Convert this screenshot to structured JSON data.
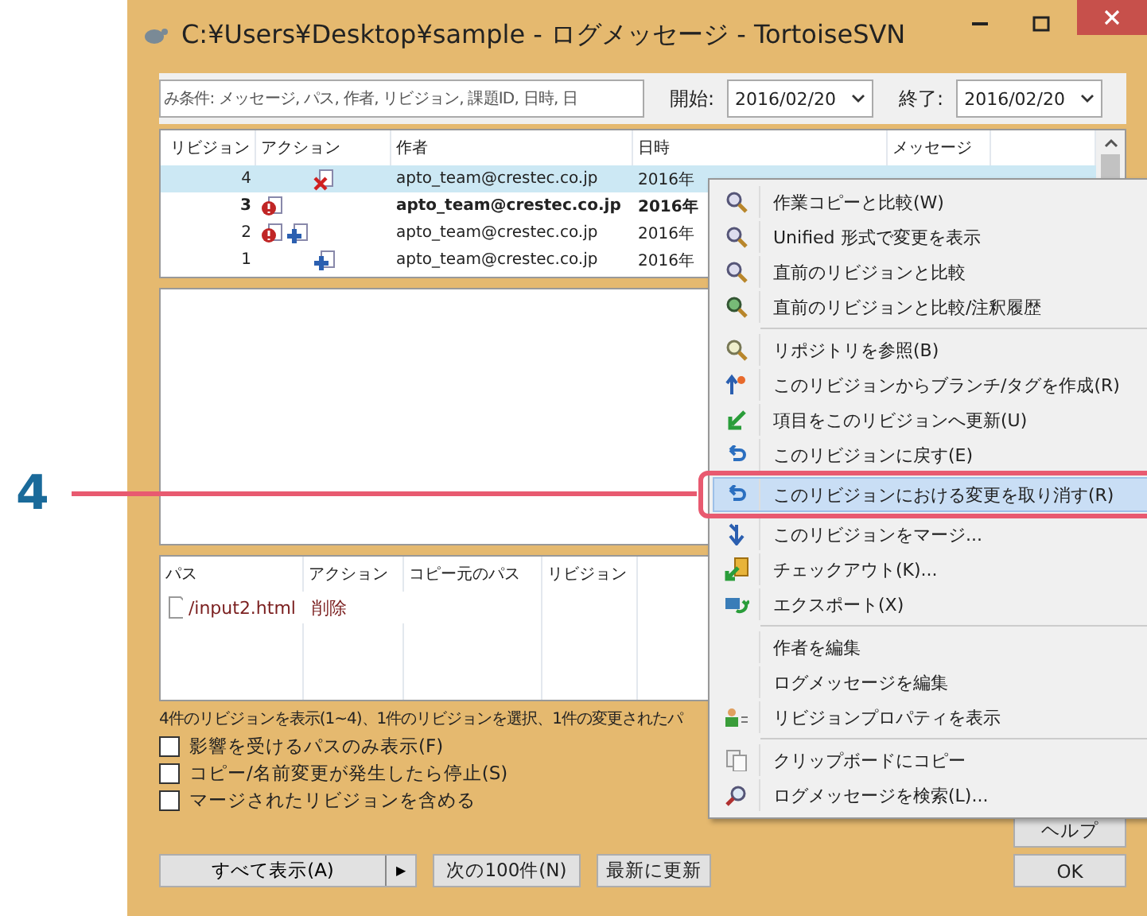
{
  "window": {
    "title": "C:¥Users¥Desktop¥sample - ログメッセージ - TortoiseSVN"
  },
  "filter": {
    "placeholder": "み条件: メッセージ, パス, 作者, リビジョン, 課題ID, 日時, 日",
    "from_label": "開始:",
    "from_value": "2016/02/20",
    "to_label": "終了:",
    "to_value": "2016/02/20"
  },
  "log_table": {
    "columns": [
      "リビジョン",
      "アクション",
      "作者",
      "日時",
      "メッセージ"
    ],
    "rows": [
      {
        "revision": "4",
        "deleted": true,
        "replaced": false,
        "added": false,
        "author": "apto_team@crestec.co.jp",
        "date": "2016年",
        "selected": true,
        "bold": false
      },
      {
        "revision": "3",
        "deleted": false,
        "replaced": true,
        "added": false,
        "author": "apto_team@crestec.co.jp",
        "date": "2016年",
        "selected": false,
        "bold": true
      },
      {
        "revision": "2",
        "deleted": false,
        "replaced": true,
        "added": true,
        "author": "apto_team@crestec.co.jp",
        "date": "2016年",
        "selected": false,
        "bold": false
      },
      {
        "revision": "1",
        "deleted": false,
        "replaced": false,
        "added": true,
        "author": "apto_team@crestec.co.jp",
        "date": "2016年",
        "selected": false,
        "bold": false
      }
    ]
  },
  "paths_table": {
    "columns": [
      "パス",
      "アクション",
      "コピー元のパス",
      "リビジョン"
    ],
    "rows": [
      {
        "path": "/input2.html",
        "action": "削除"
      }
    ]
  },
  "status": "4件のリビジョンを表示(1~4)、1件のリビジョンを選択、1件の変更されたパ",
  "options": [
    {
      "label": "影響を受けるパスのみ表示(F)",
      "checked": false
    },
    {
      "label": "コピー/名前変更が発生したら停止(S)",
      "checked": false
    },
    {
      "label": "マージされたリビジョンを含める",
      "checked": false
    }
  ],
  "buttons": {
    "show_all": "すべて表示(A)",
    "split_arrow": "▶",
    "next": "次の100件(N)",
    "refresh": "最新に更新",
    "help": "ヘルプ",
    "ok": "OK"
  },
  "context_menu": {
    "groups": [
      [
        {
          "label": "作業コピーと比較(W)",
          "selected": false
        },
        {
          "label": "Unified 形式で変更を表示",
          "selected": false
        },
        {
          "label": "直前のリビジョンと比較",
          "selected": false
        },
        {
          "label": "直前のリビジョンと比較/注釈履歴",
          "selected": false
        }
      ],
      [
        {
          "label": "リポジトリを参照(B)",
          "selected": false
        },
        {
          "label": "このリビジョンからブランチ/タグを作成(R)",
          "selected": false
        },
        {
          "label": "項目をこのリビジョンへ更新(U)",
          "selected": false
        },
        {
          "label": "このリビジョンに戻す(E)",
          "selected": false
        },
        {
          "label": "このリビジョンにおける変更を取り消す(R)",
          "selected": true
        },
        {
          "label": "このリビジョンをマージ...",
          "selected": false
        },
        {
          "label": "チェックアウト(K)...",
          "selected": false
        },
        {
          "label": "エクスポート(X)",
          "selected": false
        }
      ],
      [
        {
          "label": "作者を編集",
          "selected": false
        },
        {
          "label": "ログメッセージを編集",
          "selected": false
        },
        {
          "label": "リビジョンプロパティを表示",
          "selected": false
        }
      ],
      [
        {
          "label": "クリップボードにコピー",
          "selected": false
        },
        {
          "label": "ログメッセージを検索(L)...",
          "selected": false
        }
      ]
    ]
  },
  "callout": {
    "number": "4"
  }
}
